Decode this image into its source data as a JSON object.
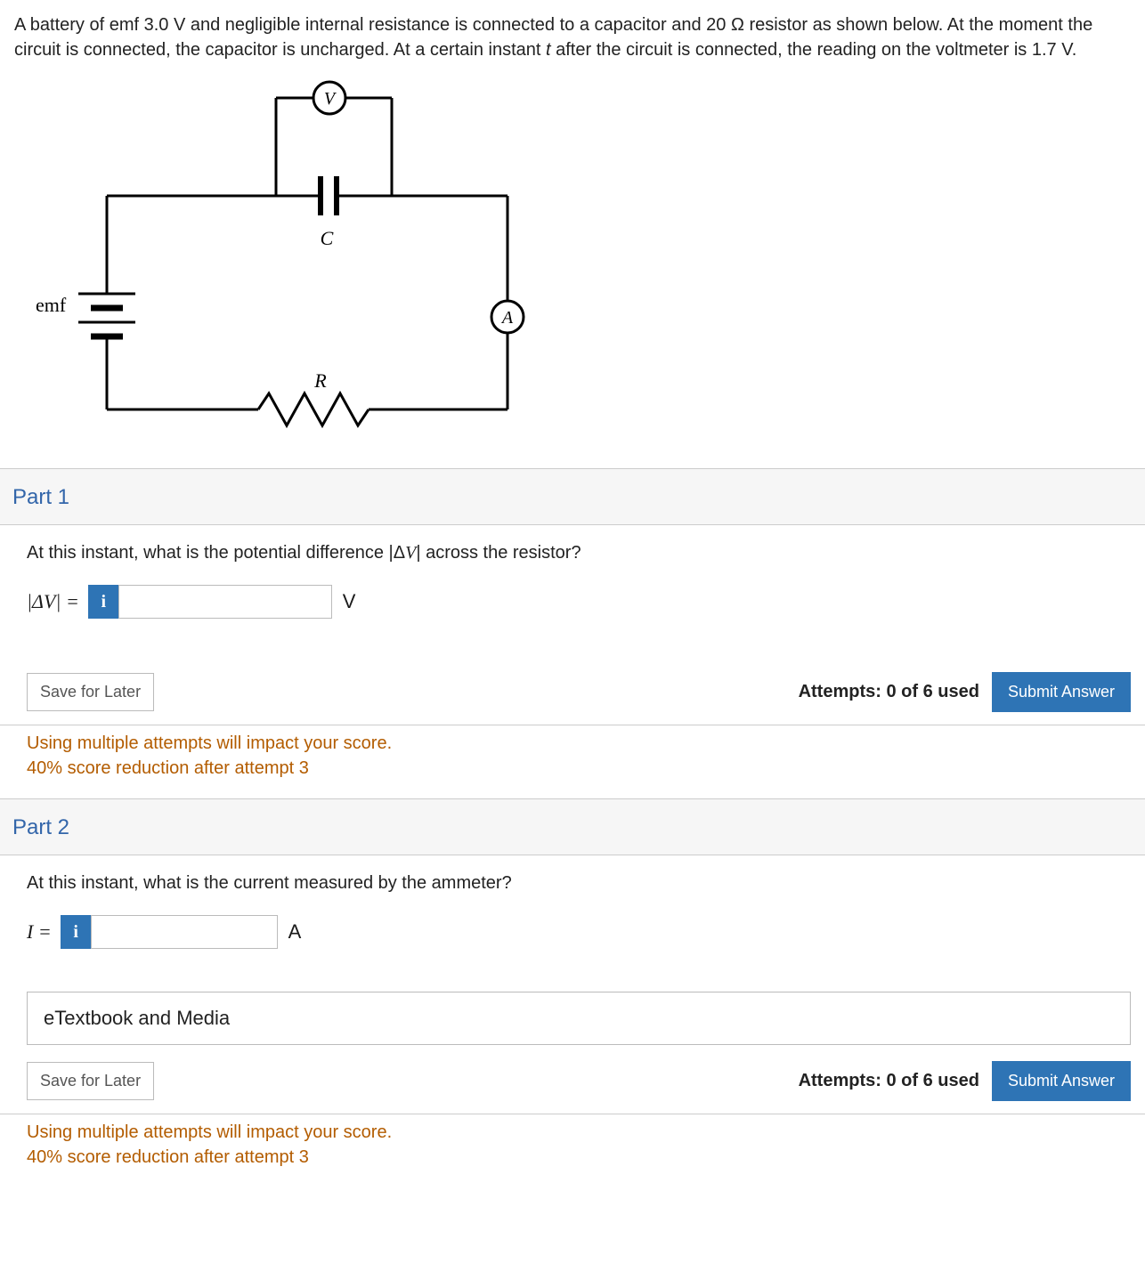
{
  "problem": {
    "text_a": "A battery of emf 3.0 V and negligible internal resistance is connected to a capacitor and 20 Ω resistor as shown below. At the moment the circuit is connected, the capacitor is uncharged. At a certain instant ",
    "var": "t",
    "text_b": " after the circuit is connected, the reading on the voltmeter is 1.7 V."
  },
  "figure": {
    "emf": "emf",
    "V": "V",
    "C": "C",
    "A": "A",
    "R": "R"
  },
  "parts": [
    {
      "title": "Part 1",
      "prompt_a": "At this instant, what is the potential difference |Δ",
      "prompt_var": "V",
      "prompt_b": "| across the resistor?",
      "label": "|ΔV|  =",
      "unit": "V",
      "info": "i",
      "save": "Save for Later",
      "attempts": "Attempts: 0 of 6 used",
      "submit": "Submit Answer",
      "hint1": "Using multiple attempts will impact your score.",
      "hint2": "40% score reduction after attempt 3",
      "show_etext": false
    },
    {
      "title": "Part 2",
      "prompt_a": "At this instant, what is the current measured by the ammeter?",
      "prompt_var": "",
      "prompt_b": "",
      "label": "I  =",
      "unit": "A",
      "info": "i",
      "save": "Save for Later",
      "attempts": "Attempts: 0 of 6 used",
      "submit": "Submit Answer",
      "hint1": "Using multiple attempts will impact your score.",
      "hint2": "40% score reduction after attempt 3",
      "etext": "eTextbook and Media",
      "show_etext": true
    }
  ]
}
